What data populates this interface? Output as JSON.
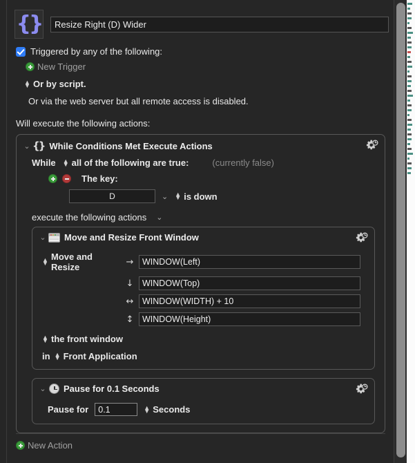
{
  "macro": {
    "icon": "curly-braces-icon",
    "name_value": "Resize Right (D) Wider"
  },
  "triggers": {
    "checkbox_label": "Triggered by any of the following:",
    "new_trigger_label": "New Trigger",
    "script_label": "Or by script.",
    "web_label": "Or via the web server but all remote access is disabled."
  },
  "actions_header": "Will execute the following actions:",
  "while_action": {
    "title": "While Conditions Met Execute Actions",
    "while_label": "While",
    "condition_mode": "all of the following are true:",
    "status": "(currently false)",
    "condition": {
      "label": "The key:",
      "key_value": "D",
      "state": "is down"
    },
    "execute_label": "execute the following actions"
  },
  "move_resize_action": {
    "title": "Move and Resize Front Window",
    "mode_label": "Move and Resize",
    "fields": [
      {
        "arrow": "→",
        "arrow_name": "arrow-right-icon",
        "value": "WINDOW(Left)"
      },
      {
        "arrow": "↓",
        "arrow_name": "arrow-down-icon",
        "value": "WINDOW(Top)"
      },
      {
        "arrow": "↔",
        "arrow_name": "arrow-horizontal-icon",
        "value": "WINDOW(WIDTH) + 10"
      },
      {
        "arrow": "↕",
        "arrow_name": "arrow-vertical-icon",
        "value": "WINDOW(Height)"
      }
    ],
    "target_label": "the front window",
    "in_label": "in",
    "application_label": "Front Application"
  },
  "pause_action": {
    "title": "Pause for 0.1 Seconds",
    "pause_for_label": "Pause for",
    "value": "0.1",
    "units": "Seconds"
  },
  "new_action_label": "New Action",
  "colors": {
    "background": "#262626",
    "field_background": "#1d1d1d",
    "accent_blue": "#2f7cf6",
    "add_green": "#3a9b3a",
    "remove_red": "#b23a3a",
    "macro_icon_purple": "#8c8cf0",
    "text_primary": "#ededed",
    "text_dim": "#a0a0a0"
  }
}
